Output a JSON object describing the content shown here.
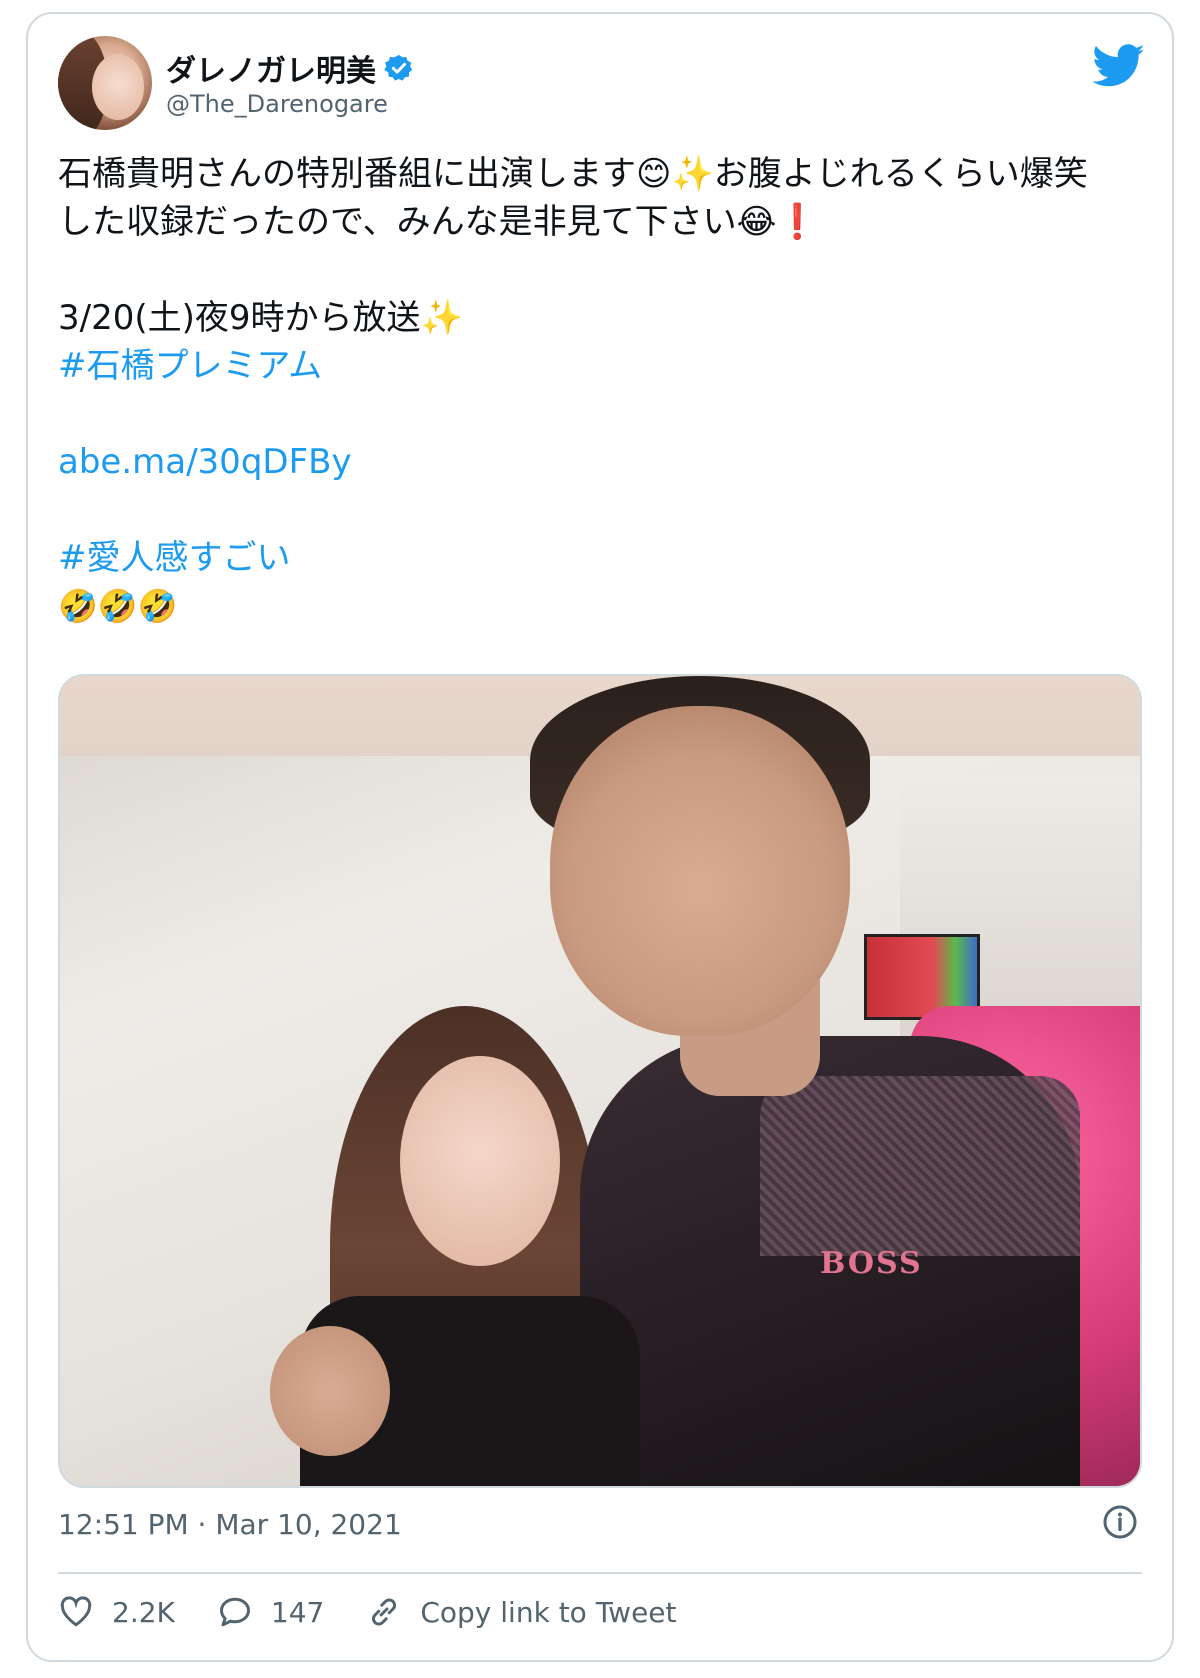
{
  "tweet": {
    "author": {
      "display_name": "ダレノガレ明美",
      "handle": "@The_Darenogare",
      "verified": true
    },
    "lines": [
      "石橋貴明さんの特別番組に出演します😊✨お腹よじれるくらい爆笑",
      "した収録だったので、みんな是非見て下さい😂❗"
    ],
    "broadcast": "3/20(土)夜9時から放送✨",
    "hashtag1": "#石橋プレミアム",
    "link": "abe.ma/30qDFBy",
    "hashtag2": "#愛人感すごい",
    "emoji_line": "🤣🤣🤣",
    "photo_text": "BOSS",
    "timestamp": "12:51 PM · Mar 10, 2021",
    "likes": "2.2K",
    "replies": "147",
    "copy_link": "Copy link to Tweet"
  },
  "colors": {
    "accent": "#1d9bf0",
    "text": "#0f1419",
    "secondary": "#536471",
    "border": "#cfd9de"
  },
  "icons": [
    "twitter-bird-icon",
    "verified-badge-icon",
    "info-icon",
    "heart-icon",
    "reply-icon",
    "link-icon"
  ]
}
